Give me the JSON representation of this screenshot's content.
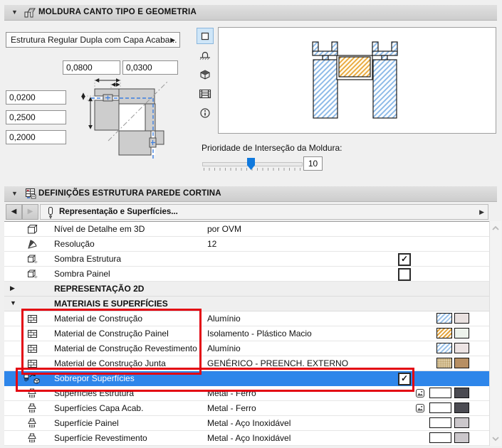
{
  "icons": {
    "collapse": "▼",
    "expand": "▶",
    "flyout_arrow": "▶",
    "nav_back": "◀",
    "nav_forward": "▶",
    "check": "✓"
  },
  "colors": {
    "selected_row": "#2e86ea",
    "annotation_red": "#e30613",
    "slider_thumb": "#1079dd",
    "hatch_blue": "#9cc3ea",
    "hatch_orange": "#e2a23c",
    "swatch_aluminio_surface": "#e9e1e0",
    "swatch_isolamento_surface": "#edf3ec",
    "swatch_junta_surface": "#b78f63",
    "swatch_metal_ferro": "#4b4b52",
    "swatch_aco_inoxidavel": "#cbc7cb"
  },
  "panel_moldura": {
    "title": "MOLDURA CANTO TIPO E GEOMETRIA",
    "type_value": "Estrutura Regular Dupla com Capa Acaba...",
    "inputs": {
      "top1": "0,0800",
      "top2": "0,0300",
      "left1": "0,0200",
      "left2": "0,2500",
      "left3": "0,2000"
    },
    "priority": {
      "label": "Prioridade de Interseção da Moldura:",
      "value": "10",
      "percent": 48
    }
  },
  "panel_definicoes": {
    "title": "DEFINIÇÕES ESTRUTURA PAREDE CORTINA",
    "tab_label": "Representação e Superfícies...",
    "rows": [
      {
        "label": "Nível de Detalhe em 3D",
        "value": "por OVM"
      },
      {
        "label": "Resolução",
        "value": "12"
      },
      {
        "label": "Sombra Estrutura",
        "checked": true
      },
      {
        "label": "Sombra Painel",
        "checked": false
      },
      {
        "group": "REPRESENTAÇÃO 2D",
        "expanded": false
      },
      {
        "group": "MATERIAIS E SUPERFÍCIES",
        "expanded": true
      },
      {
        "label": "Material de Construção",
        "value": "Alumínio",
        "swatch_pattern": "blue-hatch",
        "swatch_solid": "#e9e1e0"
      },
      {
        "label": "Material de Construção Painel",
        "value": "Isolamento - Plástico Macio",
        "swatch_pattern": "orange-hatch",
        "swatch_solid": "#edf3ec"
      },
      {
        "label": "Material de Construção Revestimento",
        "value": "Alumínio",
        "swatch_pattern": "blue-hatch",
        "swatch_solid": "#ece3e3"
      },
      {
        "label": "Material de Construção Junta",
        "value": "GENÉRICO - PREENCH. EXTERNO",
        "swatch_pattern": "beige-check",
        "swatch_solid": "#b78f63"
      },
      {
        "label": "Sobrepor Superfícies",
        "checked": true,
        "selected": true
      },
      {
        "label": "Superfícies Estrutura",
        "value": "Metal - Ferro",
        "texture": true,
        "swatch_solid": "#4b4b52"
      },
      {
        "label": "Superfícies Capa Acab.",
        "value": "Metal - Ferro",
        "texture": true,
        "swatch_solid": "#4b4b52"
      },
      {
        "label": "Superfície Painel",
        "value": "Metal - Aço Inoxidável",
        "texture": false,
        "swatch_solid": "#cbc7cb"
      },
      {
        "label": "Superfície Revestimento",
        "value": "Metal - Aço Inoxidável",
        "texture": false,
        "swatch_solid": "#cbc7cb"
      }
    ]
  }
}
